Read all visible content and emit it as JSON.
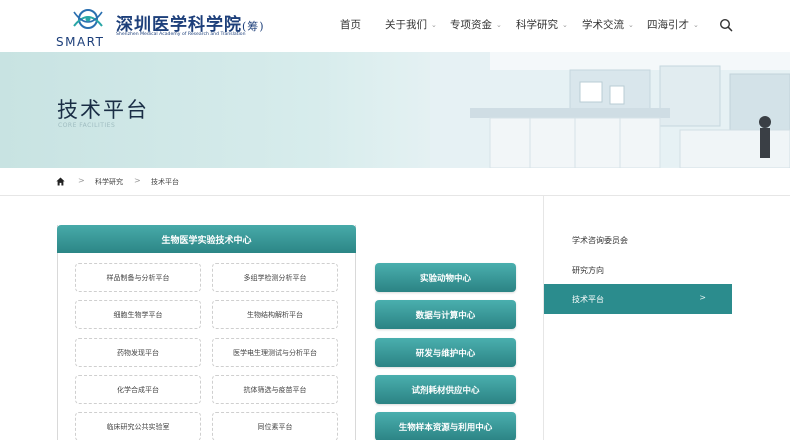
{
  "header": {
    "logo_cn": "深圳医学科学院",
    "logo_paren": "(筹)",
    "logo_en": "Shenzhen Medical Academy of Research and Translation",
    "logo_smart": "SMART",
    "nav": [
      {
        "label": "首页",
        "has_dropdown": false
      },
      {
        "label": "关于我们",
        "has_dropdown": true
      },
      {
        "label": "专项资金",
        "has_dropdown": true
      },
      {
        "label": "科学研究",
        "has_dropdown": true
      },
      {
        "label": "学术交流",
        "has_dropdown": true
      },
      {
        "label": "四海引才",
        "has_dropdown": true
      }
    ],
    "search_icon": "search-icon"
  },
  "banner": {
    "title": "技术平台",
    "subtitle": "CORE FACILITIES"
  },
  "breadcrumb": {
    "home_icon": "home-icon",
    "items": [
      "科学研究",
      "技术平台"
    ],
    "separator": ">"
  },
  "center_panel": {
    "title": "生物医学实验技术中心",
    "platforms": [
      "样品制备与分析平台",
      "多组学检测分析平台",
      "细胞生物学平台",
      "生物结构解析平台",
      "药物发现平台",
      "医学电生理测试与分析平台",
      "化学合成平台",
      "抗体筛选与疫苗平台",
      "临床研究公共实验室",
      "同位素平台"
    ]
  },
  "centers": [
    "实验动物中心",
    "数据与计算中心",
    "研发与维护中心",
    "试剂耗材供应中心",
    "生物样本资源与利用中心"
  ],
  "side_menu": {
    "items": [
      {
        "label": "学术咨询委员会",
        "active": false
      },
      {
        "label": "研究方向",
        "active": false
      },
      {
        "label": "技术平台",
        "active": true
      }
    ],
    "active_arrow": ">"
  },
  "colors": {
    "teal": "#2b8c8d",
    "navy": "#1d3f7a",
    "banner_bg": "#d3eaea"
  }
}
